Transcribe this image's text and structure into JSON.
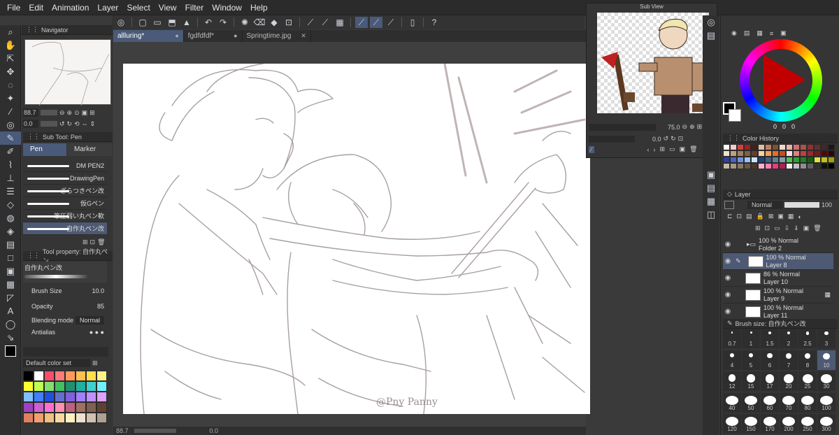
{
  "menu": [
    "File",
    "Edit",
    "Animation",
    "Layer",
    "Select",
    "View",
    "Filter",
    "Window",
    "Help"
  ],
  "tabs": [
    {
      "label": "allluring*",
      "active": true
    },
    {
      "label": "fgdfdfdf*",
      "active": false
    },
    {
      "label": "Springtime.jpg",
      "active": false
    }
  ],
  "navigator": {
    "title": "Navigator",
    "zoom": "88.7",
    "rotation": "0.0"
  },
  "subtool": {
    "title": "Sub Tool: Pen",
    "tab_pen": "Pen",
    "tab_marker": "Marker",
    "brushes": [
      "DM PEN2",
      "DrawingPen",
      "ざらつきペン改",
      "仮Gペン",
      "筆圧弱い丸ペン軟",
      "自作丸ペン改"
    ],
    "active_brush": "自作丸ペン改"
  },
  "tool_property": {
    "title": "Tool property: 自作丸ペン",
    "brush_name": "自作丸ペン改",
    "brush_size_label": "Brush Size",
    "brush_size": "10.0",
    "opacity_label": "Opacity",
    "opacity": "85",
    "blending_label": "Blending mode",
    "blending": "Normal",
    "antialias_label": "Antialias"
  },
  "colorset": {
    "label": "Default color set"
  },
  "status": {
    "zoom": "88.7",
    "angle": "0.0"
  },
  "subview": {
    "title": "Sub View",
    "zoom": "75.0",
    "angle": "0.0"
  },
  "color_wheel": {
    "r": "0",
    "g": "0",
    "b": "0"
  },
  "color_history": {
    "title": "Color History"
  },
  "layer_panel": {
    "title": "Layer",
    "blend": "Normal",
    "opacity": "100",
    "layers": [
      {
        "pct": "100 % Normal",
        "name": "Folder 2",
        "folder": true,
        "active": false
      },
      {
        "pct": "100 % Normal",
        "name": "Layer 8",
        "folder": false,
        "active": true
      },
      {
        "pct": "86 % Normal",
        "name": "Layer 10",
        "folder": false,
        "active": false
      },
      {
        "pct": "100 % Normal",
        "name": "Layer 9",
        "folder": false,
        "active": false
      },
      {
        "pct": "100 % Normal",
        "name": "Layer 11",
        "folder": false,
        "active": false
      }
    ]
  },
  "brush_size_panel": {
    "title": "Brush size: 自作丸ペン改",
    "sizes": [
      "0.7",
      "1",
      "1.5",
      "2",
      "2.5",
      "3",
      "4",
      "5",
      "6",
      "7",
      "8",
      "10",
      "12",
      "15",
      "17",
      "20",
      "25",
      "30",
      "40",
      "50",
      "60",
      "70",
      "80",
      "100",
      "120",
      "150",
      "170",
      "200",
      "250",
      "300"
    ],
    "active": "10"
  },
  "signature": "@Pny Panny",
  "colors": {
    "accent": "#4a5a7a",
    "panel": "#353535",
    "menubar": "#2b2b2b"
  }
}
